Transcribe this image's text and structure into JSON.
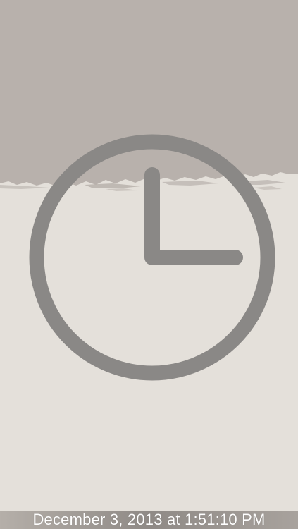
{
  "colors": {
    "top_band": "#b8b1ac",
    "bottom_band": "#e4e0da",
    "clock_stroke": "#8a8886",
    "footer_bar": "#9e9995",
    "footer_text": "#ffffff"
  },
  "clock": {
    "icon": "clock-icon"
  },
  "footer": {
    "timestamp": "December 3, 2013 at 1:51:10 PM"
  }
}
